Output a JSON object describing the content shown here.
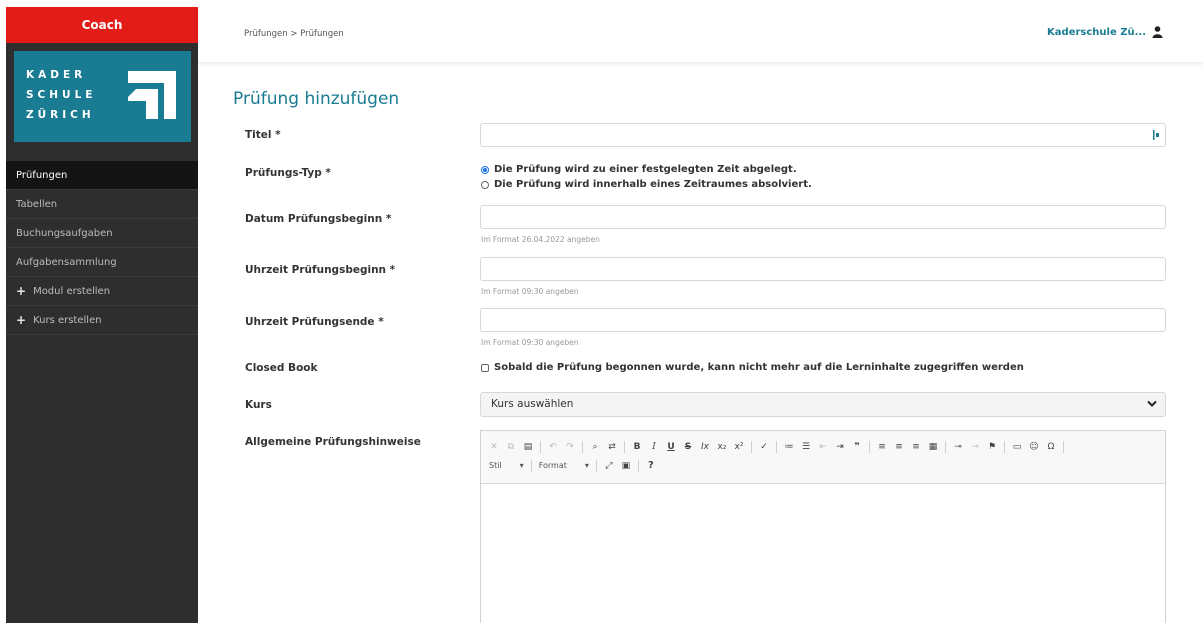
{
  "sidebar": {
    "role": "Coach",
    "logo_lines": [
      "KADER",
      "SCHULE",
      "ZÜRICH"
    ],
    "items": [
      {
        "label": "Prüfungen",
        "active": true
      },
      {
        "label": "Tabellen"
      },
      {
        "label": "Buchungsaufgaben"
      },
      {
        "label": "Aufgabensammlung"
      },
      {
        "label": "Modul erstellen",
        "icon": "plus-icon"
      },
      {
        "label": "Kurs erstellen",
        "icon": "plus-icon"
      }
    ]
  },
  "header": {
    "breadcrumb": "Prüfungen > Prüfungen",
    "user": "Kaderschule Zü..."
  },
  "form": {
    "title": "Prüfung hinzufügen",
    "titel_label": "Titel *",
    "typ_label": "Prüfungs-Typ *",
    "typ_option_1": "Die Prüfung wird zu einer festgelegten Zeit abgelegt.",
    "typ_option_2": "Die Prüfung wird innerhalb eines Zeitraumes absolviert.",
    "datum_label": "Datum Prüfungsbeginn *",
    "datum_hint": "Im Format 26.04.2022 angeben",
    "start_label": "Uhrzeit Prüfungsbeginn *",
    "start_hint": "Im Format 09:30 angeben",
    "end_label": "Uhrzeit Prüfungsende *",
    "end_hint": "Im Format 09:30 angeben",
    "closed_label": "Closed Book",
    "closed_text": "Sobald die Prüfung begonnen wurde, kann nicht mehr auf die Lerninhalte zugegriffen werden",
    "kurs_label": "Kurs",
    "kurs_value": "Kurs auswählen",
    "hinweise_label": "Allgemeine Prüfungshinweise"
  },
  "editor": {
    "stil_label": "Stil",
    "format_label": "Format",
    "help": "?"
  },
  "colors": {
    "accent": "#1a7c93",
    "role_red": "#e31c18",
    "sidebar": "#2e2e2e"
  }
}
